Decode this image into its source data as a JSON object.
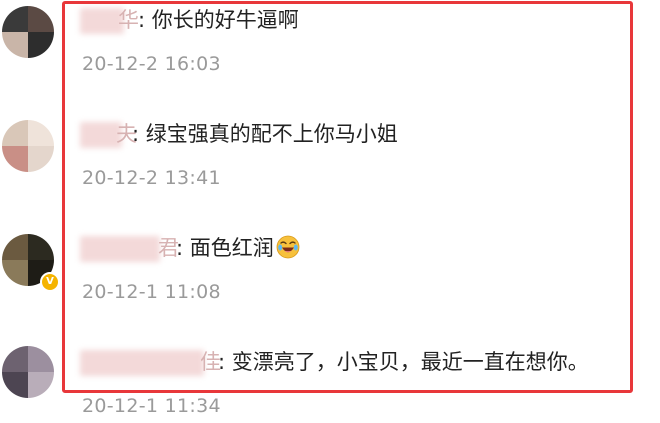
{
  "comments": [
    {
      "name_tail": "华",
      "text": ": 你长的好牛逼啊",
      "time": "20-12-2 16:03",
      "avatar_colors": [
        "#3a3a3a",
        "#5b4a44",
        "#c9b5a8",
        "#2d2d2d"
      ],
      "verified": false,
      "emoji": ""
    },
    {
      "name_tail": "夫",
      "text": ": 绿宝强真的配不上你马小姐",
      "time": "20-12-2 13:41",
      "avatar_colors": [
        "#d9c7b8",
        "#efe3da",
        "#c98f86",
        "#e4d6cc"
      ],
      "verified": false,
      "emoji": ""
    },
    {
      "name_tail": "君",
      "text": ": 面色红润",
      "time": "20-12-1 11:08",
      "avatar_colors": [
        "#6b5a40",
        "#2c2a20",
        "#8a7a5a",
        "#1e1c16"
      ],
      "verified": true,
      "emoji": "laughing-tears-emoji"
    },
    {
      "name_tail": "佳",
      "text": ": 变漂亮了，小宝贝，最近一直在想你。",
      "time": "20-12-1 11:34",
      "avatar_colors": [
        "#6d6270",
        "#9c8f9f",
        "#4d4552",
        "#b9adb9"
      ],
      "verified": false,
      "emoji": ""
    }
  ],
  "colors": {
    "highlight_border": "#e8373a",
    "text": "#222222",
    "time": "#9a9a9a",
    "name_blur": "#f3d9d9",
    "verified_badge": "#f5b400"
  },
  "verified_badge_glyph": "V"
}
